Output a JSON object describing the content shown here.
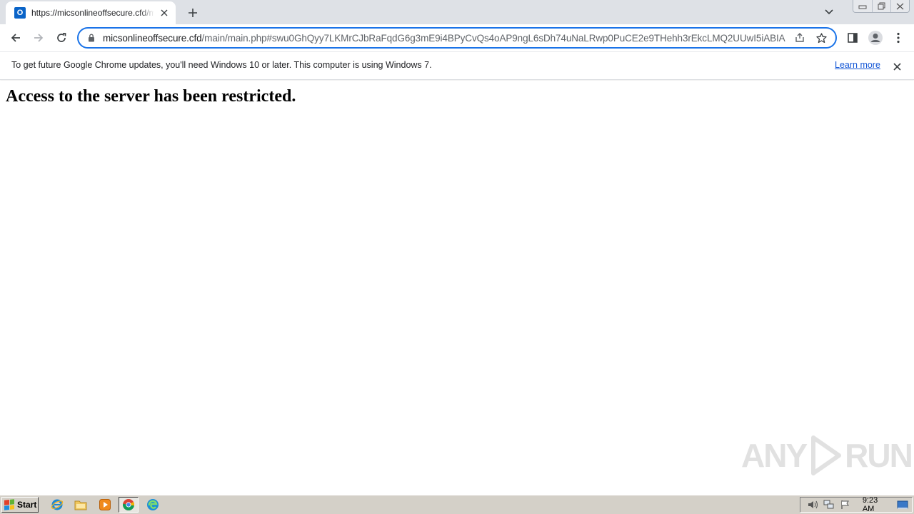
{
  "tab": {
    "title": "https://micsonlineoffsecure.cfd/main/main.php",
    "favicon_letter": "O"
  },
  "omnibox": {
    "host": "micsonlineoffsecure.cfd",
    "path": "/main/main.php#swu0GhQyy7LKMrCJbRaFqdG6g3mE9i4BPyCvQs4oAP9ngL6sDh74uNaLRwp0PuCE2e9THehh3rEkcLMQ2UUwI5iABIA"
  },
  "infobar": {
    "message": "To get future Google Chrome updates, you'll need Windows 10 or later. This computer is using Windows 7.",
    "link_label": "Learn more"
  },
  "page": {
    "heading": "Access to the server has been restricted."
  },
  "watermark": {
    "left": "ANY",
    "right": "RUN"
  },
  "taskbar": {
    "start_label": "Start",
    "clock": "9:23 AM"
  },
  "colors": {
    "accent": "#1a73e8",
    "tabstrip": "#dee1e6",
    "taskbar": "#d4d0c8",
    "outlook_blue": "#0a64c8"
  }
}
